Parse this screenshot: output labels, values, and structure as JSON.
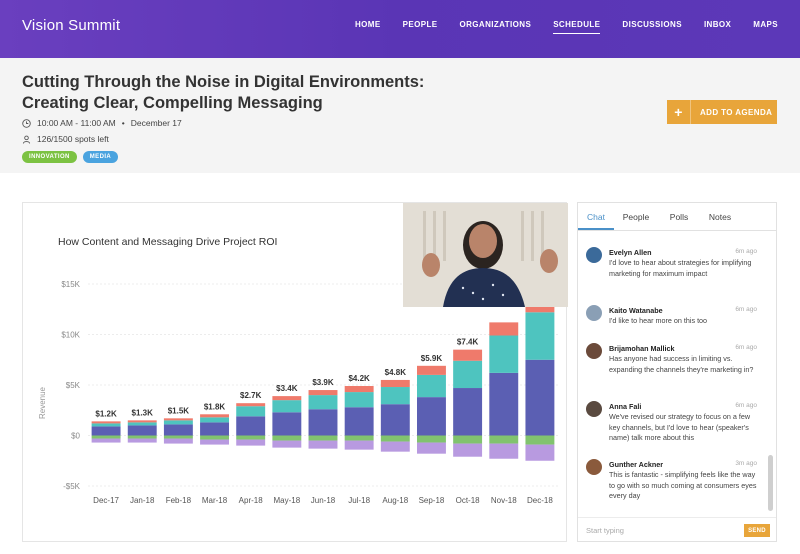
{
  "app": {
    "brand": "Vision Summit"
  },
  "nav": {
    "items": [
      {
        "label": "HOME"
      },
      {
        "label": "PEOPLE"
      },
      {
        "label": "ORGANIZATIONS"
      },
      {
        "label": "SCHEDULE",
        "active": true
      },
      {
        "label": "DISCUSSIONS"
      },
      {
        "label": "INBOX"
      },
      {
        "label": "MAPS"
      }
    ]
  },
  "session": {
    "title_line1": "Cutting Through the Noise in Digital Environments:",
    "title_line2": "Creating Clear, Compelling Messaging",
    "time": "10:00 AM - 11:00 AM",
    "separator": "•",
    "date": "December 17",
    "spots": "126/1500 spots left",
    "tags": [
      {
        "label": "INNOVATION",
        "color": "#7cc242"
      },
      {
        "label": "MEDIA",
        "color": "#4aa3df"
      }
    ],
    "add_button_plus": "+",
    "add_button_label": "ADD TO AGENDA"
  },
  "chart_data": {
    "type": "bar",
    "title": "How Content and Messaging Drive Project ROI",
    "ylabel": "Revenue",
    "xlabel": "",
    "ylim": [
      -5000,
      15000
    ],
    "yticks": [
      "$15K",
      "$10K",
      "$5K",
      "$0",
      "-$5K"
    ],
    "categories": [
      "Dec-17",
      "Jan-18",
      "Feb-18",
      "Mar-18",
      "Apr-18",
      "May-18",
      "Jun-18",
      "Jul-18",
      "Aug-18",
      "Sep-18",
      "Oct-18",
      "Nov-18",
      "Dec-18"
    ],
    "totals": [
      "$1.2K",
      "$1.3K",
      "$1.5K",
      "$1.8K",
      "$2.7K",
      "$3.4K",
      "$3.9K",
      "$4.2K",
      "$4.8K",
      "$5.9K",
      "$7.4K",
      "",
      ""
    ],
    "series": [
      {
        "values": [
          900,
          1000,
          1100,
          1300,
          1900,
          2300,
          2600,
          2800,
          3100,
          3800,
          4700,
          6200,
          7500
        ],
        "color": "#5b5fb3"
      },
      {
        "values": [
          300,
          300,
          400,
          500,
          1000,
          1200,
          1400,
          1500,
          1700,
          2200,
          2700,
          3700,
          4700
        ],
        "color": "#4ec4bf"
      },
      {
        "values": [
          200,
          200,
          200,
          300,
          300,
          400,
          500,
          600,
          700,
          900,
          1100,
          1300,
          1600
        ],
        "color": "#ef7a6b"
      },
      {
        "values": [
          -300,
          -300,
          -300,
          -400,
          -400,
          -500,
          -500,
          -500,
          -600,
          -700,
          -800,
          -800,
          -900
        ],
        "color": "#81c36e"
      },
      {
        "values": [
          -400,
          -400,
          -500,
          -500,
          -600,
          -700,
          -800,
          -900,
          -1000,
          -1100,
          -1300,
          -1500,
          -1600
        ],
        "color": "#b89ae0"
      }
    ]
  },
  "chat": {
    "tabs": [
      {
        "label": "Chat",
        "active": true
      },
      {
        "label": "People"
      },
      {
        "label": "Polls"
      },
      {
        "label": "Notes"
      }
    ],
    "messages": [
      {
        "name": "Evelyn Allen",
        "time": "6m ago",
        "text": "I'd love to hear about strategies for implifying marketing for maximum impact",
        "avatar_color": "#3b6a9a"
      },
      {
        "name": "Kaito Watanabe",
        "time": "6m ago",
        "text": "I'd like to hear more on this too",
        "avatar_color": "#8a9fb5"
      },
      {
        "name": "Brijamohan Mallick",
        "time": "6m ago",
        "text": "Has anyone had success in limiting vs. expanding the channels they're marketing in?",
        "avatar_color": "#6b4a3a"
      },
      {
        "name": "Anna Fali",
        "time": "6m ago",
        "text": "We've revised our strategy to focus on a few key channels, but I'd love to hear (speaker's name) talk more about this",
        "avatar_color": "#5a4a40"
      },
      {
        "name": "Gunther Ackner",
        "time": "3m ago",
        "text": "This is fantastic - simplifying feels like the way to go with so much coming at consumers eyes every day",
        "avatar_color": "#8a5a3c"
      }
    ],
    "input_placeholder": "Start typing",
    "send_label": "SEND"
  }
}
